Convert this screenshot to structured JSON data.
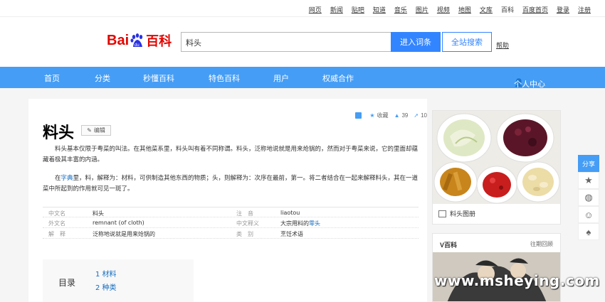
{
  "top_links": [
    "网页",
    "新闻",
    "贴吧",
    "知道",
    "音乐",
    "图片",
    "视频",
    "地图",
    "文库",
    "百科",
    "百度首页",
    "登录",
    "注册"
  ],
  "logo": {
    "bai": "Bai",
    "baike": "百科",
    "brand_color": "#e10601"
  },
  "search": {
    "value": "料头",
    "enter_label": "进入词条",
    "all_label": "全站搜索",
    "help_label": "帮助"
  },
  "nav": {
    "items": [
      "首页",
      "分类",
      "秒懂百科",
      "特色百科",
      "用户",
      "权威合作"
    ],
    "user_center": "个人中心",
    "color": "#459df5"
  },
  "toolbar": {
    "collect": "收藏",
    "like_count": "39",
    "share_count": "10"
  },
  "entry": {
    "title": "料头",
    "edit_label": "编辑",
    "para1": "料头基本仅限于粤菜的叫法。在其他菜系里，料头叫有着不同称谓。料头，泛称地说就是用来炝锅的，然而对于粤菜来说，它的里面却蕴藏着极其丰富的内涵。",
    "para2_pre": "在",
    "para2_link": "字典",
    "para2_post": "里，料，解释为：材料，可供制造其他东西的物质；头，则解释为：次序在最前，第一。将二者结合在一起来解释料头，其在一道菜中所起到的作用就可见一斑了。"
  },
  "basic_info": [
    {
      "k1": "中文名",
      "v1": "料头",
      "k2": "注　音",
      "v2": "liaotou",
      "v2_link": ""
    },
    {
      "k1": "外文名",
      "v1": "remnant (of cloth)",
      "k2": "中文释义",
      "v2": "大宗用料的",
      "v2_link": "零头"
    },
    {
      "k1": "解　释",
      "v1": "泛称地说就是用来炝锅的",
      "k2": "类　别",
      "v2": "烹饪术语",
      "v2_link": ""
    }
  ],
  "toc": {
    "label": "目录",
    "items": [
      "1  材料",
      "2  种类"
    ]
  },
  "album": {
    "caption": "料头图册"
  },
  "ybox": {
    "header": "V百科",
    "more": "往期回顾"
  },
  "share": {
    "label": "分享"
  },
  "watermark": "www.msheying.com"
}
